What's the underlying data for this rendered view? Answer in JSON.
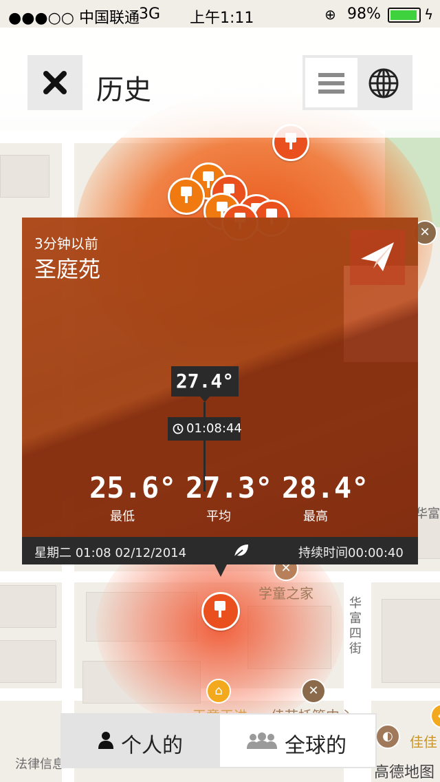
{
  "status_bar": {
    "carrier": "●●●○○ 中国联通",
    "network": "3G",
    "time": "上午1:11",
    "battery": "98%"
  },
  "nav": {
    "title": "历史",
    "close_icon": "close-icon",
    "list_icon": "list-icon",
    "globe_icon": "globe-icon"
  },
  "card": {
    "time_ago": "3分钟以前",
    "place": "圣庭苑",
    "current_temp": "27.4°",
    "time": "01:08:44",
    "stats": [
      {
        "value": "25.6°",
        "label": "最低"
      },
      {
        "value": "27.3°",
        "label": "平均"
      },
      {
        "value": "28.4°",
        "label": "最高"
      }
    ],
    "footer": {
      "date": "星期二 01:08 02/12/2014",
      "duration": "持续时间00:00:40"
    }
  },
  "map": {
    "labels": {
      "school": "学童之家",
      "street": "华富四街",
      "huafu": "华富",
      "laws": "法律信息",
      "jiaju": "佳佳",
      "tuoguan": "佳苗托管中心",
      "amap": "高德地图",
      "partial": "王童王进"
    }
  },
  "bottom_tabs": {
    "personal": "个人的",
    "global": "全球的"
  },
  "colors": {
    "accent": "#ea4f1e",
    "dark": "#2b2b2b"
  }
}
